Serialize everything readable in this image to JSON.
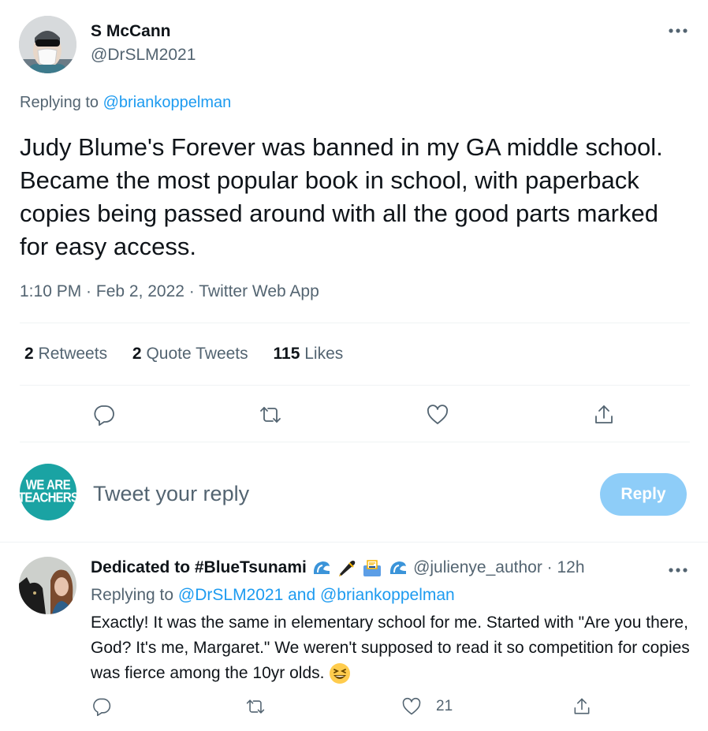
{
  "tweet": {
    "author_name": "S McCann",
    "author_handle": "@DrSLM2021",
    "replying_prefix": "Replying to",
    "replying_to": "@briankoppelman",
    "text": "Judy Blume's Forever was banned in my GA middle school. Became the most popular book in school, with paperback copies being passed around with all the good parts marked for easy access.",
    "meta": "1:10 PM · Feb 2, 2022 · Twitter Web App",
    "stats": {
      "retweets_count": "2",
      "retweets_label": "Retweets",
      "quotes_count": "2",
      "quotes_label": "Quote Tweets",
      "likes_count": "115",
      "likes_label": "Likes"
    },
    "more_icon": "more-horizontal-icon"
  },
  "composer": {
    "avatar_text_line1": "WE ARE",
    "avatar_text_line2": "TEACHERS",
    "placeholder": "Tweet your reply",
    "reply_button": "Reply"
  },
  "reply": {
    "author_name": "Dedicated to #BlueTsunami",
    "handle_time": "@julienye_author · 12h",
    "replying_prefix": "Replying to",
    "replying_to": "@DrSLM2021 and @briankoppelman",
    "text": "Exactly! It was the same in elementary school for me. Started with \"Are you there, God? It's me, Margaret.\" We weren't supposed to read it so competition for copies was fierce among the 10yr olds.",
    "likes_count": "21"
  },
  "colors": {
    "accent": "#1d9bf0",
    "reply_button_disabled": "#8ecdf8",
    "teal_avatar": "#1aa3a3",
    "muted": "#536471"
  }
}
